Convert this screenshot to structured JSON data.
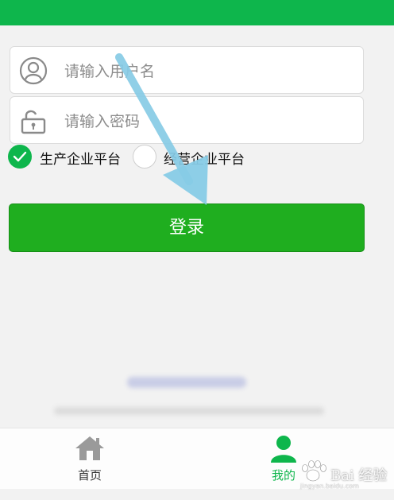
{
  "form": {
    "username_placeholder": "请输入用户名",
    "password_placeholder": "请输入密码",
    "platform_options": [
      {
        "label": "生产企业平台",
        "selected": true
      },
      {
        "label": "经营企业平台",
        "selected": false
      }
    ],
    "login_label": "登录"
  },
  "tabbar": {
    "tabs": [
      {
        "label": "首页",
        "icon": "home-icon",
        "active": false
      },
      {
        "label": "我的",
        "icon": "person-icon",
        "active": true
      }
    ]
  },
  "colors": {
    "brand_green": "#0eb64c",
    "button_green": "#1fae1f",
    "arrow_blue": "#87cbe6"
  },
  "watermark": {
    "brand_text": "Bai 经验",
    "url_text": "jingyan.baidu.com"
  }
}
